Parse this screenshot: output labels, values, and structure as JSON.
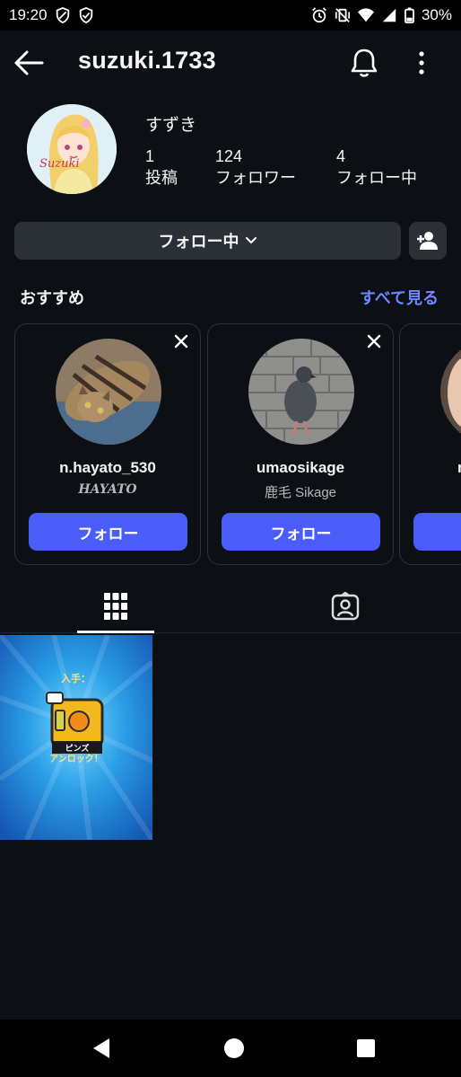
{
  "status_bar": {
    "time": "19:20",
    "battery": "30%",
    "icons": [
      "shield-icon",
      "shield-icon",
      "alarm-icon",
      "vibrate-icon",
      "wifi-icon",
      "signal-icon",
      "battery-icon"
    ]
  },
  "header": {
    "username": "suzuki.1733",
    "icons": [
      "back-arrow-icon",
      "bell-icon",
      "more-vertical-icon"
    ]
  },
  "profile": {
    "avatar_text": "Suzuki",
    "display_name": "すずき",
    "stats": [
      {
        "value": "1",
        "label": "投稿"
      },
      {
        "value": "124",
        "label": "フォロワー"
      },
      {
        "value": "4",
        "label": "フォロー中"
      }
    ]
  },
  "actions": {
    "following_label": "フォロー中",
    "add_person_icon": "person-add-icon"
  },
  "suggestions": {
    "title": "おすすめ",
    "see_all": "すべて見る",
    "items": [
      {
        "handle": "n.hayato_530",
        "name": "HAYATO",
        "button": "フォロー"
      },
      {
        "handle": "umaosikage",
        "name": "鹿毛 Sikage",
        "button": "フォロー"
      },
      {
        "handle": "n",
        "name": "",
        "button": ""
      }
    ]
  },
  "tabs": {
    "icons": [
      "grid-icon",
      "tagged-icon"
    ]
  },
  "posts": [
    {
      "caption_top": "入手：",
      "badge": "ピンズ",
      "caption_bottom": "アンロック！"
    }
  ],
  "colors": {
    "background": "#0c1014",
    "accent": "#4a5df9",
    "link": "#6c87ff",
    "button_dark": "#2b3036"
  },
  "nav_bar": {
    "icons": [
      "back-triangle-icon",
      "home-circle-icon",
      "recents-square-icon"
    ]
  }
}
